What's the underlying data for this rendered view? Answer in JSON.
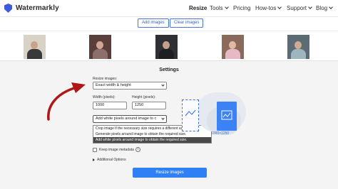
{
  "header": {
    "brand": "Watermarkly",
    "nav": [
      {
        "label": "Resize",
        "active": true,
        "dropdown": false
      },
      {
        "label": "Tools",
        "active": false,
        "dropdown": true
      },
      {
        "label": "Pricing",
        "active": false,
        "dropdown": false
      },
      {
        "label": "How-tos",
        "active": false,
        "dropdown": true
      },
      {
        "label": "Support",
        "active": false,
        "dropdown": true
      },
      {
        "label": "Blog",
        "active": false,
        "dropdown": true
      }
    ]
  },
  "toolbar": {
    "add_images": "Add images",
    "clear_images": "Clear images"
  },
  "thumbnails": [
    {
      "bg": "#d9d2c7",
      "face": "#c9a48c",
      "body": "#3a3a3a"
    },
    {
      "bg": "#5a3e3a",
      "face": "#d1a692",
      "body": "#8c6f6b"
    },
    {
      "bg": "#2f3036",
      "face": "#c7a08c",
      "body": "#1e1f22"
    },
    {
      "bg": "#8a6a5a",
      "face": "#e3b8a2",
      "body": "#e7b9c4"
    },
    {
      "bg": "#5b6c74",
      "face": "#d0a992",
      "body": "#9fb5be"
    }
  ],
  "settings": {
    "title": "Settings",
    "resize_label": "Resize images:",
    "resize_value": "Exact width & height",
    "width_label": "Width (pixels):",
    "width_value": "1000",
    "height_label": "Height (pixels):",
    "height_value": "1250",
    "fit_value": "Add white pixels around image to c",
    "fit_options": [
      "Crop image if the necessary size requires a different aspect ratio.",
      "Generate pixels around image to obtain the required size.",
      "Add white pixels around image to obtain the required size."
    ],
    "keep_metadata": "Keep image metadata",
    "additional_options": "Additional Options",
    "resize_button": "Resize images",
    "dimension_label": "1000×1250"
  },
  "colors": {
    "brand": "#3d5bd9",
    "primary": "#2f7ff5",
    "arrow": "#b01616"
  }
}
